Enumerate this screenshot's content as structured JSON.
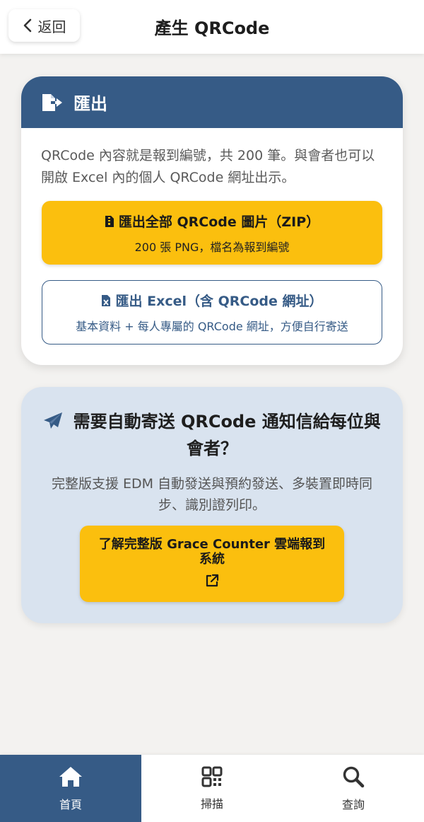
{
  "header": {
    "back_label": "返回",
    "title": "產生 QRCode"
  },
  "export": {
    "heading": "匯出",
    "description": "QRCode 內容就是報到編號，共 200 筆。與會者也可以開啟 Excel 內的個人 QRCode 網址出示。",
    "zip_button": {
      "label": "匯出全部 QRCode 圖片（ZIP）",
      "sublabel": "200 張 PNG，檔名為報到編號"
    },
    "excel_button": {
      "label": "匯出 Excel（含 QRCode 網址）",
      "sublabel": "基本資料 + 每人專屬的 QRCode 網址，方便自行寄送"
    }
  },
  "promo": {
    "title": "需要自動寄送 QRCode 通知信給每位與會者？",
    "description": "完整版支援 EDM 自動發送與預約發送、多裝置即時同步、識別證列印。",
    "button_label": "了解完整版 Grace Counter 雲端報到系統"
  },
  "bottom_nav": {
    "items": [
      {
        "label": "首頁",
        "icon": "home-icon",
        "active": true
      },
      {
        "label": "掃描",
        "icon": "qr-scan-icon",
        "active": false
      },
      {
        "label": "查詢",
        "icon": "search-icon",
        "active": false
      }
    ]
  },
  "colors": {
    "primary": "#365b86",
    "accent": "#fbbf0e",
    "promo_bg": "#d9e3ef",
    "page_bg": "#f3f2f0"
  }
}
